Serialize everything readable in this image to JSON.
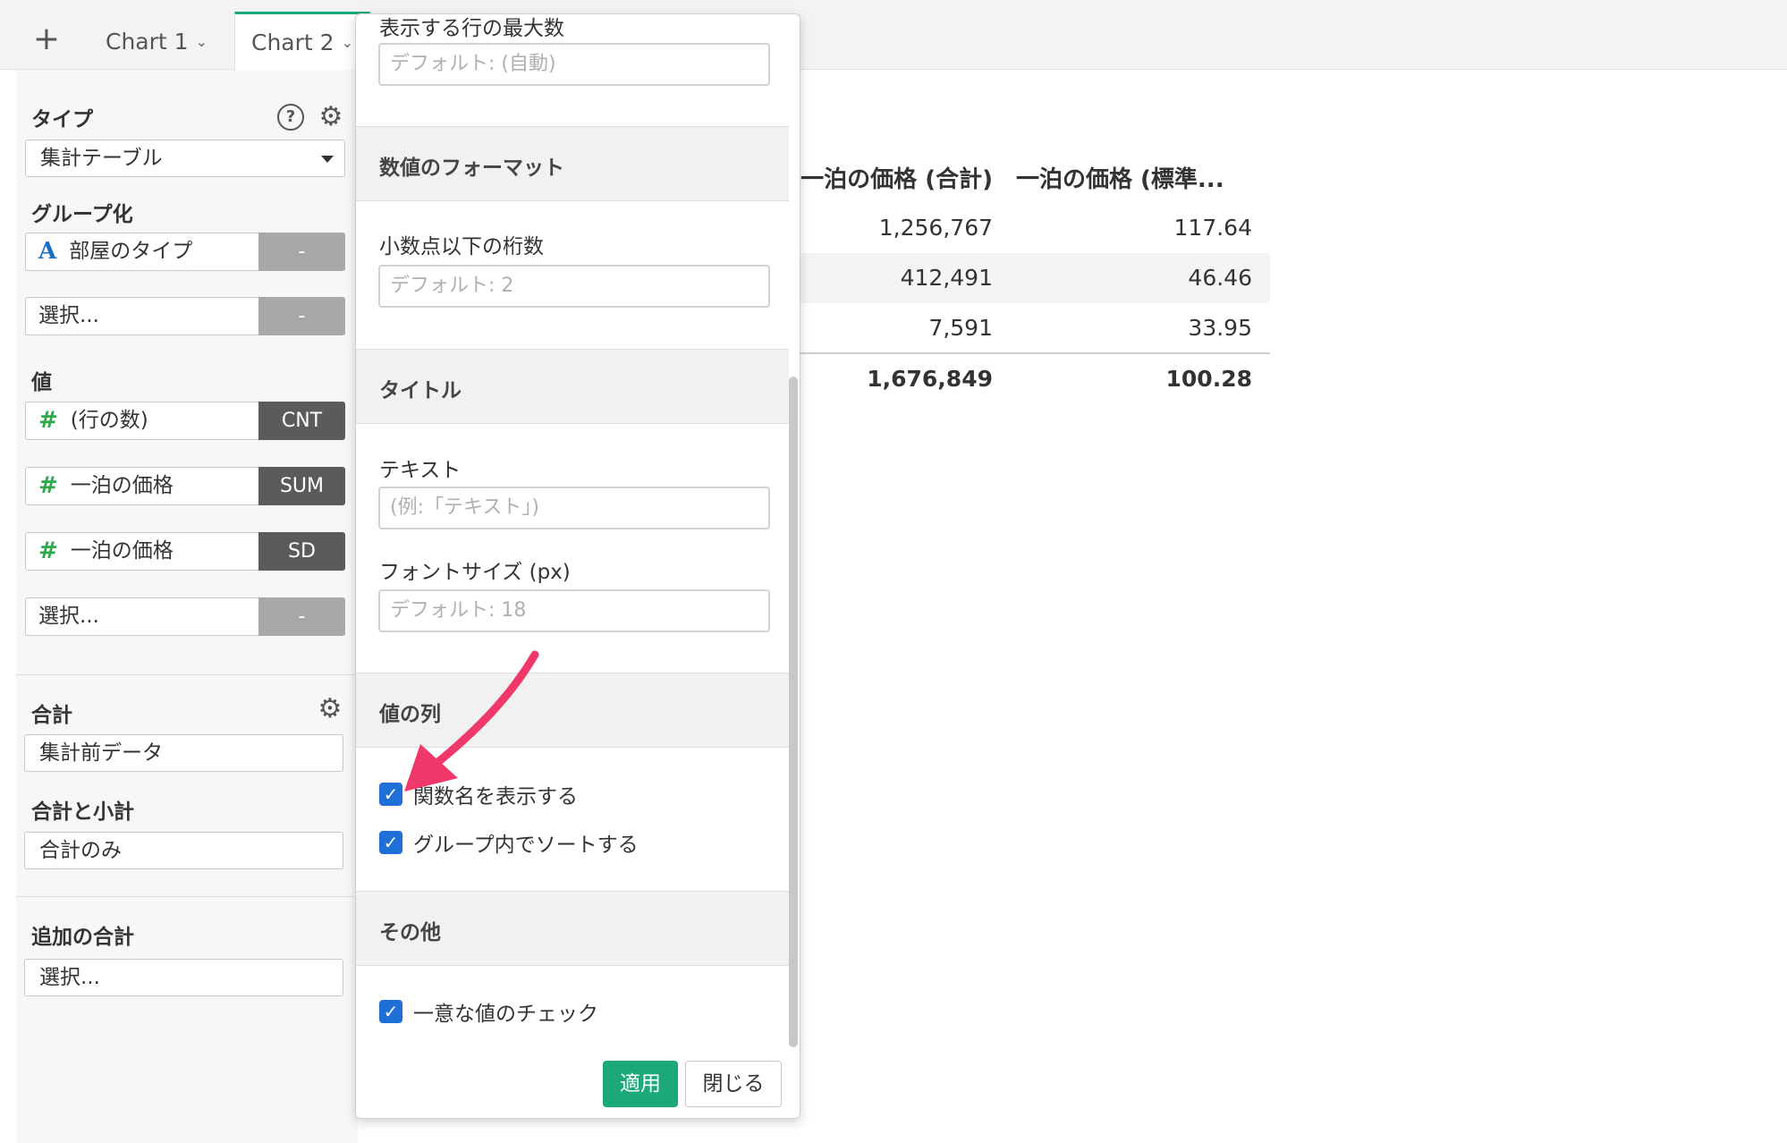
{
  "tabs": {
    "add_label": "+",
    "items": [
      {
        "label": "Chart 1"
      },
      {
        "label": "Chart 2"
      }
    ]
  },
  "sidebar": {
    "type_label": "タイプ",
    "type_value": "集計テーブル",
    "group_label": "グループ化",
    "group_fields": [
      {
        "name": "部屋のタイプ",
        "agg": "-"
      },
      {
        "name": "選択...",
        "agg": "-"
      }
    ],
    "value_label": "値",
    "value_fields": [
      {
        "name": "(行の数)",
        "agg": "CNT"
      },
      {
        "name": "一泊の価格",
        "agg": "SUM"
      },
      {
        "name": "一泊の価格",
        "agg": "SD"
      },
      {
        "name": "選択...",
        "agg": "-"
      }
    ],
    "total_label": "合計",
    "total_value": "集計前データ",
    "subtotal_label": "合計と小計",
    "subtotal_value": "合計のみ",
    "extra_total_label": "追加の合計",
    "extra_total_value": "選択..."
  },
  "table": {
    "headers": [
      "一泊の価格 (合計)",
      "一泊の価格 (標準..."
    ],
    "rows": [
      [
        "1,256,767",
        "117.64"
      ],
      [
        "412,491",
        "46.46"
      ],
      [
        "7,591",
        "33.95"
      ]
    ],
    "totals": [
      "1,676,849",
      "100.28"
    ]
  },
  "popup": {
    "max_rows_label": "表示する行の最大数",
    "max_rows_placeholder": "デフォルト: (自動)",
    "number_format_header": "数値のフォーマット",
    "decimals_label": "小数点以下の桁数",
    "decimals_placeholder": "デフォルト: 2",
    "title_header": "タイトル",
    "text_label": "テキスト",
    "text_placeholder": "(例:「テキスト」)",
    "font_size_label": "フォントサイズ (px)",
    "font_size_placeholder": "デフォルト: 18",
    "value_columns_header": "値の列",
    "show_function_name": "関数名を表示する",
    "sort_in_group": "グループ内でソートする",
    "other_header": "その他",
    "unique_check": "一意な値のチェック",
    "apply_label": "適用",
    "close_label": "閉じる"
  },
  "colors": {
    "accent": "#1ba97a",
    "checkbox": "#1f6fd9",
    "annotation_arrow": "#f0386b"
  }
}
